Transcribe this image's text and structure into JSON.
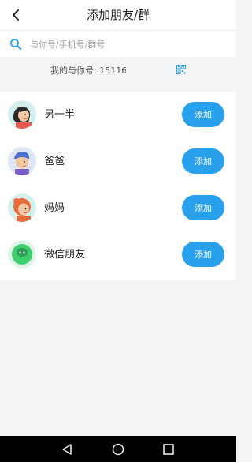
{
  "header": {
    "title": "添加朋友/群",
    "back_icon": "chevron-left-icon"
  },
  "search": {
    "placeholder": "与你号/手机号/群号",
    "value": ""
  },
  "my_id": {
    "label": "我的与你号: 15116",
    "qr_icon": "qr-code-icon"
  },
  "friends": [
    {
      "label": "另一半",
      "avatar": "woman-avatar",
      "button": "添加"
    },
    {
      "label": "爸爸",
      "avatar": "dad-avatar",
      "button": "添加"
    },
    {
      "label": "妈妈",
      "avatar": "mom-avatar",
      "button": "添加"
    },
    {
      "label": "微信朋友",
      "avatar": "wechat-icon",
      "button": "添加"
    }
  ],
  "nav": {
    "back": "back-triangle-icon",
    "home": "home-circle-icon",
    "recents": "recents-square-icon"
  },
  "colors": {
    "accent": "#28a0ec",
    "background": "#f3f4f6",
    "wechat": "#3ecf6e"
  }
}
